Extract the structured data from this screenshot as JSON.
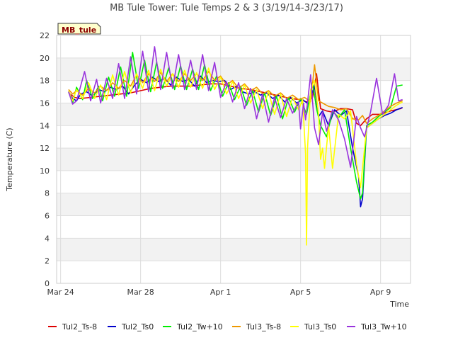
{
  "chart_data": {
    "type": "line",
    "title": "MB Tule Tower: Tule Temps 2 & 3 (3/19/14-3/23/17)",
    "xlabel": "Time",
    "ylabel": "Temperature (C)",
    "badge": "MB_tule",
    "ylim": [
      0,
      22
    ],
    "yticks": [
      0,
      2,
      4,
      6,
      8,
      10,
      12,
      14,
      16,
      18,
      20,
      22
    ],
    "xlim_days": [
      -0.2,
      17.5
    ],
    "xticks": [
      {
        "day": 0,
        "label": "Mar 24"
      },
      {
        "day": 4,
        "label": "Mar 28"
      },
      {
        "day": 8,
        "label": "Apr 1"
      },
      {
        "day": 12,
        "label": "Apr 5"
      },
      {
        "day": 16,
        "label": "Apr 9"
      }
    ],
    "grid": true,
    "legend_position": "bottom",
    "series": [
      {
        "name": "Tul2_Ts-8",
        "color": "#dd0000",
        "x": [
          0.4,
          0.7,
          1.0,
          1.5,
          2.0,
          2.5,
          3.0,
          3.5,
          4.0,
          4.5,
          5.0,
          5.5,
          6.0,
          6.5,
          7.0,
          7.5,
          8.0,
          8.5,
          9.0,
          9.5,
          10.0,
          10.5,
          11.0,
          11.5,
          12.0,
          12.3,
          12.6,
          12.8,
          13.0,
          13.3,
          13.6,
          14.0,
          14.3,
          14.6,
          14.8,
          15.0,
          15.3,
          15.6,
          16.0,
          16.5,
          17.0,
          17.1
        ],
        "y": [
          16.9,
          16.5,
          16.4,
          16.5,
          16.6,
          16.7,
          16.8,
          16.9,
          17.1,
          17.3,
          17.4,
          17.5,
          17.5,
          17.5,
          17.6,
          17.7,
          17.7,
          17.5,
          17.3,
          17.2,
          17.0,
          16.8,
          16.6,
          16.4,
          16.3,
          16.1,
          16.5,
          18.6,
          15.5,
          15.3,
          15.2,
          15.5,
          15.5,
          15.4,
          14.2,
          14.0,
          14.6,
          15.0,
          15.0,
          15.3,
          15.5,
          15.6
        ]
      },
      {
        "name": "Tul2_Ts0",
        "color": "#0000cc",
        "x": [
          0.4,
          0.6,
          0.8,
          1.0,
          1.3,
          1.6,
          1.9,
          2.2,
          2.5,
          2.8,
          3.1,
          3.4,
          3.7,
          4.0,
          4.3,
          4.6,
          4.9,
          5.2,
          5.5,
          5.8,
          6.1,
          6.4,
          6.7,
          7.0,
          7.3,
          7.6,
          7.9,
          8.2,
          8.5,
          8.8,
          9.1,
          9.4,
          9.7,
          10.0,
          10.3,
          10.6,
          10.9,
          11.2,
          11.5,
          11.8,
          12.1,
          12.4,
          12.7,
          12.9,
          13.1,
          13.4,
          13.7,
          14.0,
          14.3,
          14.6,
          14.9,
          15.0,
          15.1,
          15.3,
          15.6,
          15.9,
          16.2,
          16.5,
          16.8,
          17.1
        ],
        "y": [
          17.0,
          16.4,
          16.2,
          16.8,
          17.0,
          16.6,
          17.2,
          17.0,
          17.4,
          17.2,
          17.5,
          16.8,
          17.6,
          18.1,
          17.8,
          18.3,
          17.9,
          18.2,
          17.6,
          18.3,
          17.9,
          18.1,
          17.5,
          18.4,
          17.8,
          18.0,
          17.9,
          18.0,
          17.2,
          17.5,
          17.0,
          16.8,
          17.0,
          16.7,
          16.9,
          16.4,
          16.7,
          16.1,
          16.5,
          16.0,
          16.3,
          15.9,
          17.5,
          14.8,
          15.3,
          14.0,
          15.4,
          14.9,
          15.3,
          12.0,
          9.5,
          6.8,
          7.5,
          13.8,
          14.2,
          14.6,
          14.9,
          15.1,
          15.4,
          15.6
        ]
      },
      {
        "name": "Tul2_Tw+10",
        "color": "#00ee00",
        "x": [
          0.4,
          0.6,
          0.8,
          1.1,
          1.3,
          1.6,
          1.9,
          2.1,
          2.4,
          2.7,
          3.0,
          3.3,
          3.6,
          3.9,
          4.2,
          4.5,
          4.8,
          5.1,
          5.4,
          5.7,
          6.0,
          6.3,
          6.6,
          6.9,
          7.2,
          7.5,
          7.8,
          8.1,
          8.4,
          8.7,
          9.0,
          9.3,
          9.6,
          9.9,
          10.2,
          10.5,
          10.8,
          11.1,
          11.4,
          11.7,
          12.0,
          12.3,
          12.6,
          12.8,
          13.0,
          13.3,
          13.6,
          13.9,
          14.2,
          14.5,
          14.8,
          15.0,
          15.1,
          15.3,
          15.6,
          15.9,
          16.2,
          16.5,
          16.8,
          17.1
        ],
        "y": [
          17.0,
          16.0,
          17.4,
          16.3,
          18.0,
          16.4,
          17.5,
          16.2,
          18.3,
          16.6,
          19.2,
          16.6,
          20.5,
          17.3,
          19.8,
          17.0,
          19.6,
          17.3,
          19.1,
          17.2,
          19.3,
          17.2,
          19.0,
          17.2,
          19.4,
          17.1,
          18.4,
          16.6,
          17.8,
          16.3,
          17.5,
          15.8,
          17.1,
          15.2,
          16.9,
          14.9,
          16.6,
          14.6,
          16.5,
          15.2,
          16.4,
          15.0,
          17.8,
          15.5,
          14.0,
          13.0,
          15.3,
          14.7,
          15.4,
          12.0,
          9.0,
          7.5,
          8.0,
          14.0,
          14.3,
          14.8,
          15.2,
          15.6,
          17.5,
          17.6
        ]
      },
      {
        "name": "Tul3_Ts-8",
        "color": "#ee9900",
        "x": [
          0.4,
          0.6,
          0.8,
          1.1,
          1.4,
          1.7,
          2.0,
          2.3,
          2.6,
          2.9,
          3.2,
          3.5,
          3.8,
          4.1,
          4.4,
          4.7,
          5.0,
          5.3,
          5.6,
          5.9,
          6.2,
          6.5,
          6.8,
          7.1,
          7.4,
          7.7,
          8.0,
          8.3,
          8.6,
          8.9,
          9.2,
          9.5,
          9.8,
          10.1,
          10.4,
          10.7,
          11.0,
          11.3,
          11.6,
          11.9,
          12.2,
          12.5,
          12.7,
          12.9,
          13.1,
          13.4,
          13.7,
          14.0,
          14.3,
          14.6,
          14.9,
          15.1,
          15.3,
          15.6,
          15.9,
          16.2,
          16.5,
          16.8,
          17.1
        ],
        "y": [
          17.2,
          16.8,
          17.1,
          16.7,
          17.3,
          16.9,
          17.5,
          17.1,
          17.8,
          17.3,
          18.0,
          17.5,
          18.5,
          17.8,
          18.6,
          17.9,
          18.7,
          17.9,
          18.6,
          17.9,
          18.6,
          18.0,
          18.6,
          18.0,
          18.8,
          18.0,
          18.4,
          17.6,
          18.0,
          17.3,
          17.7,
          17.1,
          17.4,
          16.8,
          17.1,
          16.6,
          16.9,
          16.4,
          16.7,
          16.3,
          16.5,
          16.1,
          19.4,
          16.2,
          16.0,
          15.7,
          15.6,
          15.4,
          15.5,
          14.6,
          14.5,
          14.9,
          14.2,
          14.6,
          14.9,
          15.3,
          15.7,
          16.0,
          16.2
        ]
      },
      {
        "name": "Tul3_Ts0",
        "color": "#ffff00",
        "x": [
          0.4,
          0.6,
          0.8,
          1.1,
          1.4,
          1.7,
          2.0,
          2.3,
          2.6,
          2.9,
          3.2,
          3.5,
          3.8,
          4.1,
          4.4,
          4.7,
          5.0,
          5.3,
          5.6,
          5.9,
          6.2,
          6.5,
          6.8,
          7.1,
          7.4,
          7.7,
          8.0,
          8.3,
          8.6,
          8.9,
          9.2,
          9.5,
          9.8,
          10.1,
          10.4,
          10.7,
          11.0,
          11.3,
          11.6,
          11.9,
          12.1,
          12.25,
          12.3,
          12.35,
          12.5,
          12.7,
          12.9,
          13.0,
          13.1,
          13.2,
          13.4,
          13.6,
          13.9,
          14.2,
          14.5,
          14.8,
          15.0,
          15.3,
          15.6,
          15.9,
          16.2,
          16.5,
          16.8,
          17.1
        ],
        "y": [
          17.1,
          16.2,
          17.2,
          16.4,
          17.8,
          16.4,
          17.6,
          16.3,
          18.5,
          16.7,
          18.8,
          16.9,
          18.6,
          17.3,
          18.9,
          17.1,
          19.0,
          17.5,
          18.6,
          17.4,
          18.9,
          17.4,
          18.7,
          17.3,
          19.1,
          17.2,
          18.3,
          16.8,
          17.9,
          16.4,
          17.6,
          16.0,
          17.2,
          15.5,
          17.0,
          15.0,
          16.8,
          14.8,
          16.5,
          15.4,
          16.3,
          11.5,
          3.4,
          12.0,
          17.2,
          18.0,
          15.0,
          11.0,
          12.0,
          10.2,
          14.0,
          10.2,
          15.0,
          14.6,
          15.3,
          10.6,
          8.5,
          13.8,
          14.2,
          14.6,
          15.0,
          15.4,
          15.8,
          16.1
        ]
      },
      {
        "name": "Tul3_Tw+10",
        "color": "#9933dd",
        "x": [
          0.4,
          0.6,
          0.8,
          1.0,
          1.2,
          1.5,
          1.8,
          2.0,
          2.3,
          2.6,
          2.9,
          3.2,
          3.5,
          3.8,
          4.1,
          4.4,
          4.7,
          5.0,
          5.3,
          5.6,
          5.9,
          6.2,
          6.5,
          6.8,
          7.1,
          7.4,
          7.7,
          8.0,
          8.3,
          8.6,
          8.9,
          9.2,
          9.5,
          9.8,
          10.1,
          10.4,
          10.7,
          11.0,
          11.3,
          11.6,
          11.9,
          12.0,
          12.15,
          12.25,
          12.5,
          12.7,
          12.9,
          13.1,
          13.3,
          13.6,
          13.9,
          14.2,
          14.5,
          14.8,
          15.0,
          15.2,
          15.5,
          15.8,
          16.1,
          16.4,
          16.7,
          16.9,
          17.1
        ],
        "y": [
          17.0,
          15.9,
          16.2,
          17.5,
          18.8,
          16.2,
          18.1,
          16.0,
          18.2,
          16.4,
          19.5,
          16.4,
          20.1,
          16.8,
          20.6,
          17.0,
          21.0,
          17.2,
          20.5,
          17.3,
          20.3,
          17.2,
          19.8,
          17.2,
          20.3,
          17.1,
          19.6,
          16.5,
          17.9,
          16.1,
          17.8,
          15.5,
          17.3,
          14.6,
          16.8,
          14.3,
          16.5,
          14.7,
          16.4,
          15.1,
          16.1,
          13.7,
          16.0,
          14.5,
          18.5,
          13.8,
          12.3,
          15.2,
          13.5,
          15.4,
          14.5,
          12.8,
          10.3,
          14.8,
          13.8,
          13.0,
          15.2,
          18.2,
          15.0,
          15.8,
          18.6,
          16.2,
          16.3
        ]
      }
    ]
  }
}
